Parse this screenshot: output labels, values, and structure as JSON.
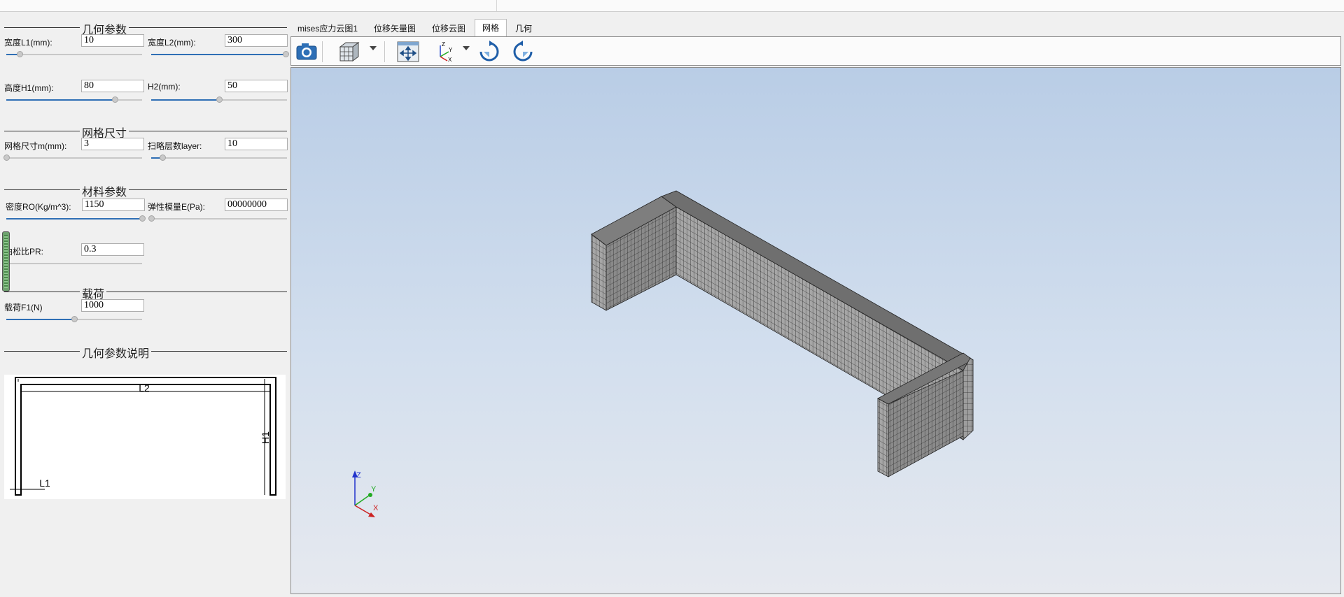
{
  "geometry_params": {
    "title": "几何参数",
    "width_l1": {
      "label": "宽度L1(mm):",
      "value": "10",
      "slider": 0.1
    },
    "width_l2": {
      "label": "宽度L2(mm):",
      "value": "300",
      "slider": 1.0
    },
    "height_h1": {
      "label": "高度H1(mm):",
      "value": "80",
      "slider": 0.8
    },
    "height_h2": {
      "label": "H2(mm):",
      "value": "50",
      "slider": 0.5
    }
  },
  "mesh_size": {
    "title": "网格尺寸",
    "mesh_m": {
      "label": "网格尺寸m(mm):",
      "value": "3",
      "slider": 0.0
    },
    "sweep_layer": {
      "label": "扫略层数layer:",
      "value": "10",
      "slider": 0.08
    }
  },
  "material": {
    "title": "材料参数",
    "density": {
      "label": "密度RO(Kg/m^3):",
      "value": "1150",
      "slider": 1.0
    },
    "modulus": {
      "label": "弹性模量E(Pa):",
      "value": "00000000",
      "slider": 0.0
    },
    "poisson": {
      "label": "泊松比PR:",
      "value": "0.3",
      "slider": 0.0
    }
  },
  "load": {
    "title": "载荷",
    "force_f1": {
      "label": "载荷F1(N)",
      "value": "1000",
      "slider": 0.5
    }
  },
  "geometry_desc": {
    "title": "几何参数说明",
    "label_l2": "L2",
    "label_h1": "H1",
    "label_l1": "L1"
  },
  "tabs": [
    {
      "label": "mises应力云图1",
      "active": false
    },
    {
      "label": "位移矢量图",
      "active": false
    },
    {
      "label": "位移云图",
      "active": false
    },
    {
      "label": "网格",
      "active": true
    },
    {
      "label": "几何",
      "active": false
    }
  ],
  "toolbar": {
    "icons": [
      "camera-icon",
      "cube-view-icon",
      "fit-view-icon",
      "axes-icon",
      "rotate-cw-icon",
      "rotate-ccw-icon"
    ],
    "axes_labels": {
      "z": "Z",
      "y": "Y",
      "x": "X"
    }
  },
  "triad": {
    "z": "Z",
    "y": "Y",
    "x": "X"
  },
  "colors": {
    "viewport_top": "#b9cde6",
    "viewport_bottom": "#e6e9ef",
    "mesh_face": "#9a9a9a",
    "accent": "#2f6fb5"
  }
}
